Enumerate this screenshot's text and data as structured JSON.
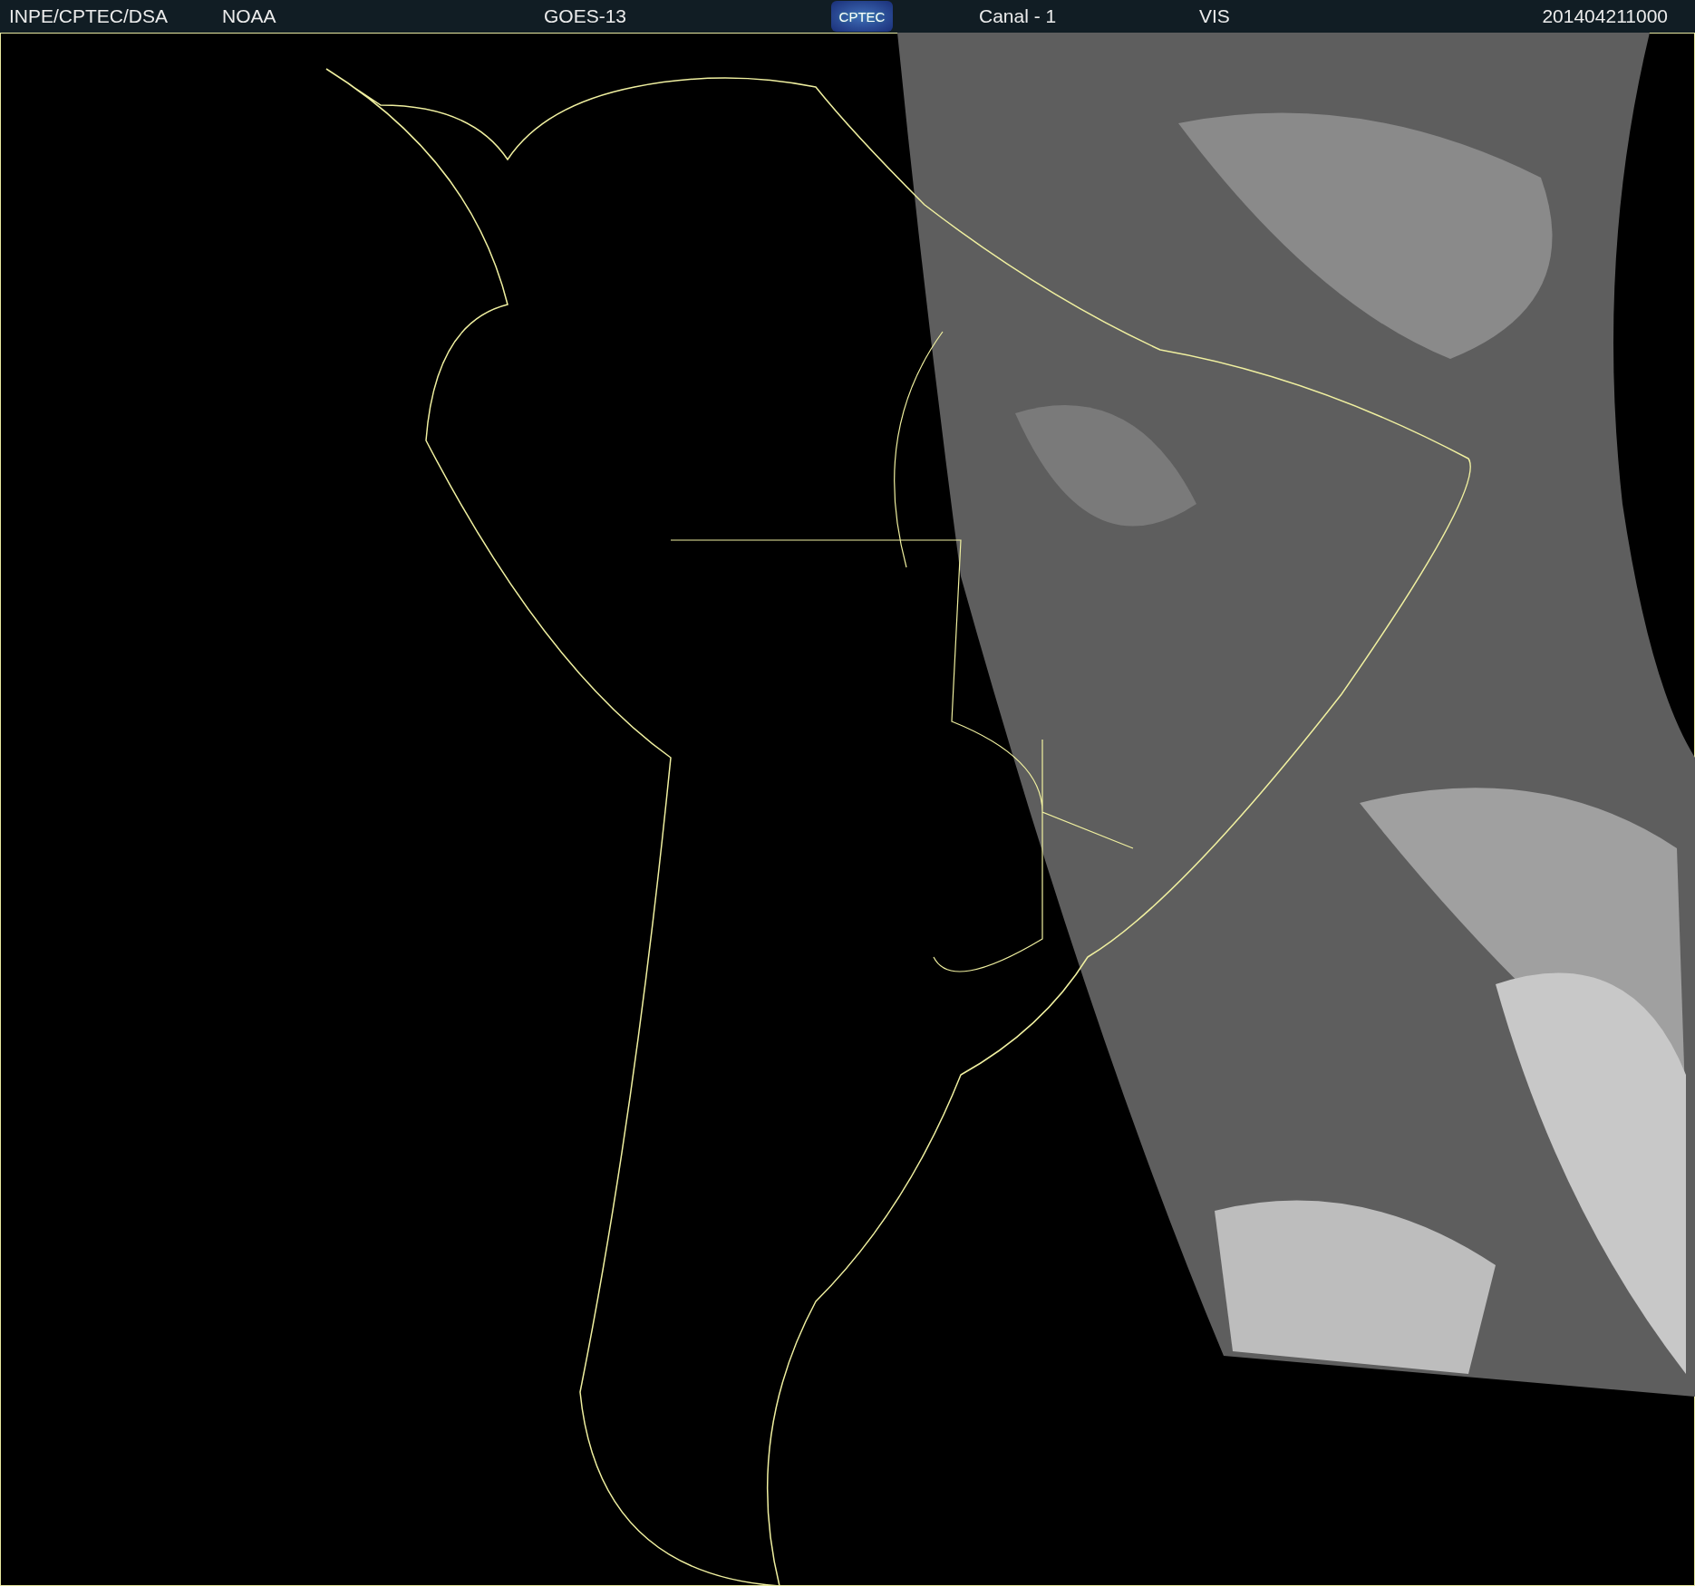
{
  "header": {
    "source": "INPE/CPTEC/DSA",
    "agency": "NOAA",
    "satellite": "GOES-13",
    "logo": "CPTEC",
    "channel": "Canal - 1",
    "band": "VIS",
    "timestamp": "201404211000"
  }
}
